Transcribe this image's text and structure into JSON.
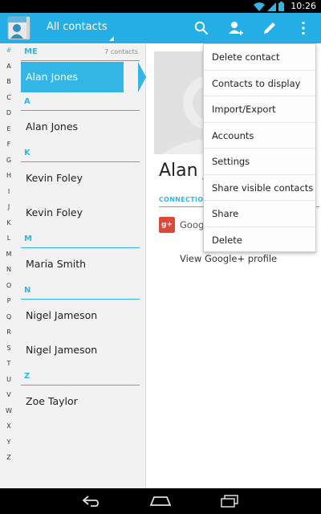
{
  "status_bar": {
    "time": "10:26",
    "icons": [
      "wifi-icon",
      "signal-icon",
      "battery-icon"
    ]
  },
  "action_bar": {
    "filter_label": "All contacts",
    "icons": [
      "search-icon",
      "add-contact-icon",
      "edit-icon",
      "overflow-menu-icon"
    ]
  },
  "index_letters": [
    "#",
    "A",
    "B",
    "C",
    "D",
    "E",
    "F",
    "G",
    "H",
    "I",
    "J",
    "K",
    "L",
    "M",
    "N",
    "O",
    "P",
    "Q",
    "R",
    "S",
    "T",
    "U",
    "V",
    "W",
    "X",
    "Y",
    "Z"
  ],
  "list": {
    "me_header": "ME",
    "me_count": "7 contacts",
    "me_contact": "Alan Jones",
    "sections": [
      {
        "letter": "A",
        "contacts": [
          "Alan Jones"
        ]
      },
      {
        "letter": "K",
        "contacts": [
          "Kevin Foley",
          "Kevin Foley"
        ]
      },
      {
        "letter": "M",
        "contacts": [
          "Maria Smith"
        ]
      },
      {
        "letter": "N",
        "contacts": [
          "Nigel Jameson",
          "Nigel Jameson"
        ]
      },
      {
        "letter": "Z",
        "contacts": [
          "Zoe Taylor"
        ]
      }
    ]
  },
  "detail": {
    "name": "Alan J",
    "connections_label": "CONNECTION",
    "gplus_badge": "g+",
    "gplus_label": "Goog",
    "view_profile": "View Google+ profile"
  },
  "overflow_menu": {
    "items": [
      "Delete contact",
      "Contacts to display",
      "Import/Export",
      "Accounts",
      "Settings",
      "Share visible contacts",
      "Share",
      "Delete"
    ]
  },
  "nav_bar": {
    "icons": [
      "back-icon",
      "home-icon",
      "recent-apps-icon"
    ]
  },
  "colors": {
    "accent": "#33b5e5",
    "actionbar": "#25aee6",
    "gplus": "#db4a39"
  }
}
